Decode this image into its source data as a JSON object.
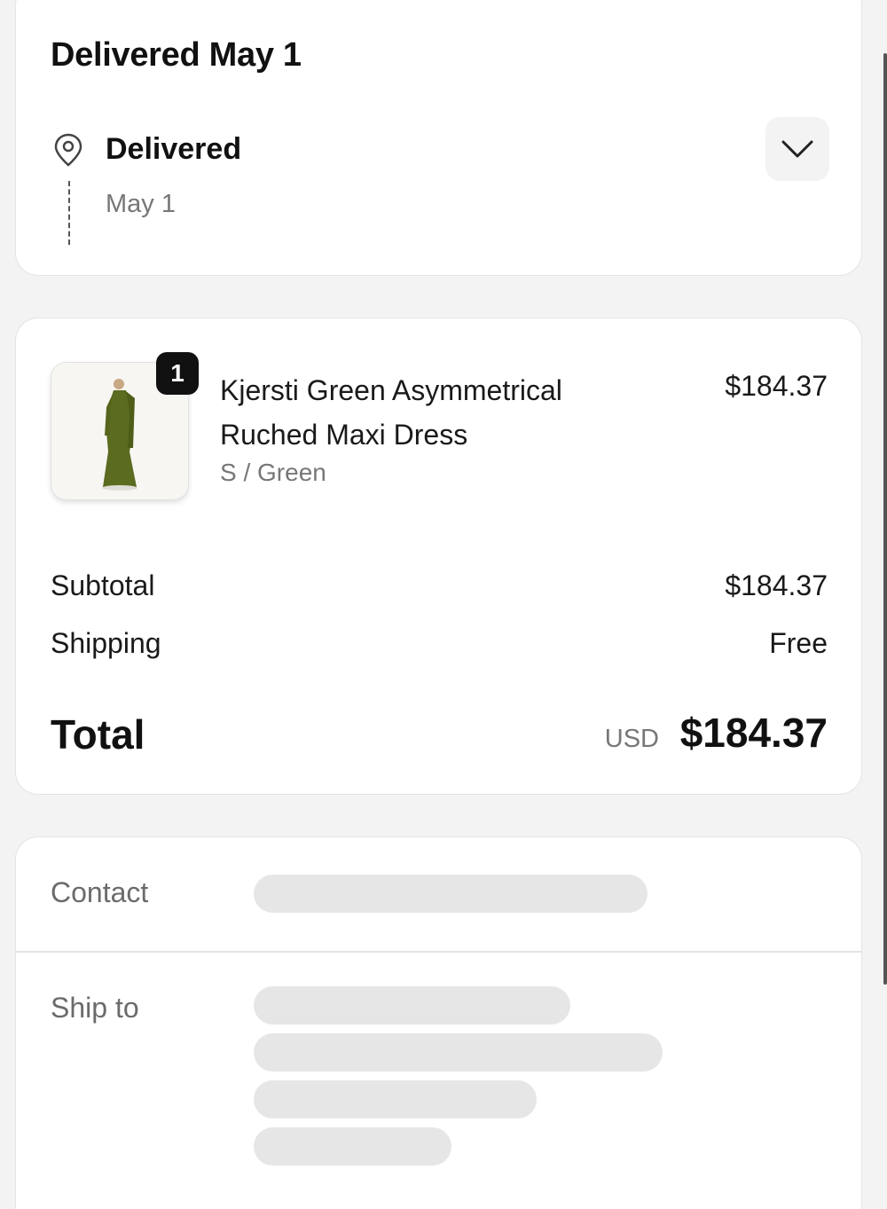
{
  "status": {
    "title": "Delivered May 1",
    "name": "Delivered",
    "date": "May 1",
    "location_icon": "map-pin-icon",
    "toggle_icon": "chevron-down-icon"
  },
  "order": {
    "item": {
      "name": "Kjersti Green Asymmetrical Ruched Maxi Dress",
      "variant": "S / Green",
      "price": "$184.37",
      "quantity": "1",
      "image": "green-maxi-dress-photo"
    },
    "subtotal_label": "Subtotal",
    "subtotal_value": "$184.37",
    "shipping_label": "Shipping",
    "shipping_value": "Free",
    "total_label": "Total",
    "currency": "USD",
    "total_value": "$184.37"
  },
  "info": {
    "contact_label": "Contact",
    "ship_to_label": "Ship to"
  }
}
